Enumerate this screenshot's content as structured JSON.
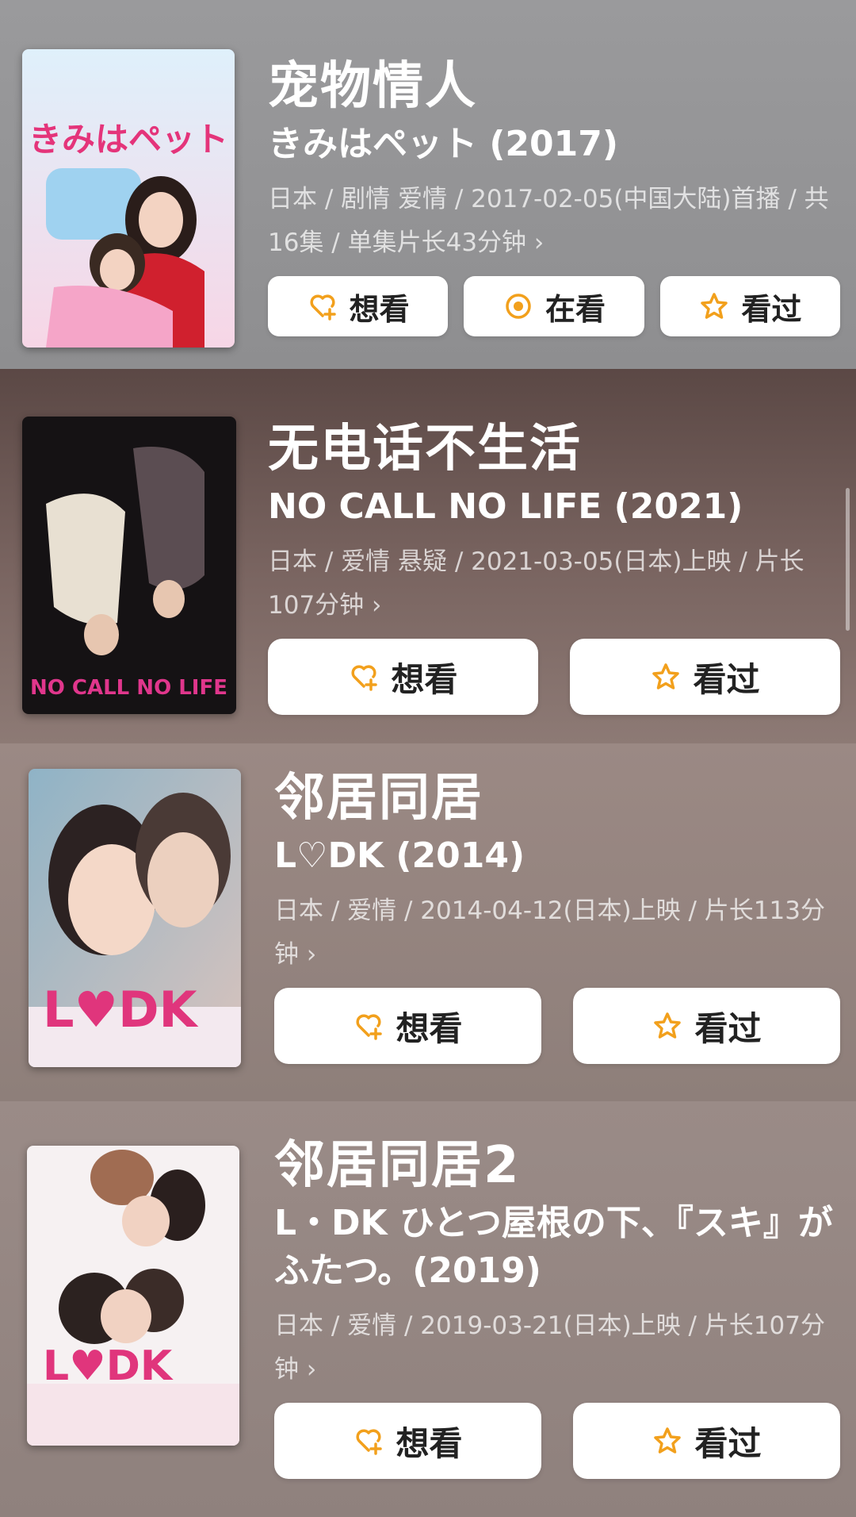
{
  "accent_color": "#f2a01c",
  "items": [
    {
      "title": "宠物情人",
      "subtitle": "きみはペット (2017)",
      "meta": "日本 / 剧情 爱情 / 2017-02-05(中国大陆)首播 / 共16集 / 单集片长43分钟 ›",
      "poster_text": "きみはペット",
      "buttons": [
        "想看",
        "在看",
        "看过"
      ]
    },
    {
      "title": "无电话不生活",
      "subtitle": "NO CALL NO LIFE (2021)",
      "meta": "日本 / 爱情 悬疑 / 2021-03-05(日本)上映 / 片长107分钟 ›",
      "poster_text": "NO CALL NO LIFE",
      "buttons": [
        "想看",
        "看过"
      ]
    },
    {
      "title": "邻居同居",
      "subtitle": "L♡DK (2014)",
      "meta": "日本 / 爱情 / 2014-04-12(日本)上映 / 片长113分钟 ›",
      "poster_text": "L♥DK",
      "buttons": [
        "想看",
        "看过"
      ]
    },
    {
      "title": "邻居同居2",
      "subtitle": "L・DK ひとつ屋根の下、『スキ』がふたつ。(2019)",
      "meta": "日本 / 爱情 / 2019-03-21(日本)上映 / 片长107分钟 ›",
      "poster_text": "L♥DK",
      "buttons": [
        "想看",
        "看过"
      ]
    }
  ]
}
